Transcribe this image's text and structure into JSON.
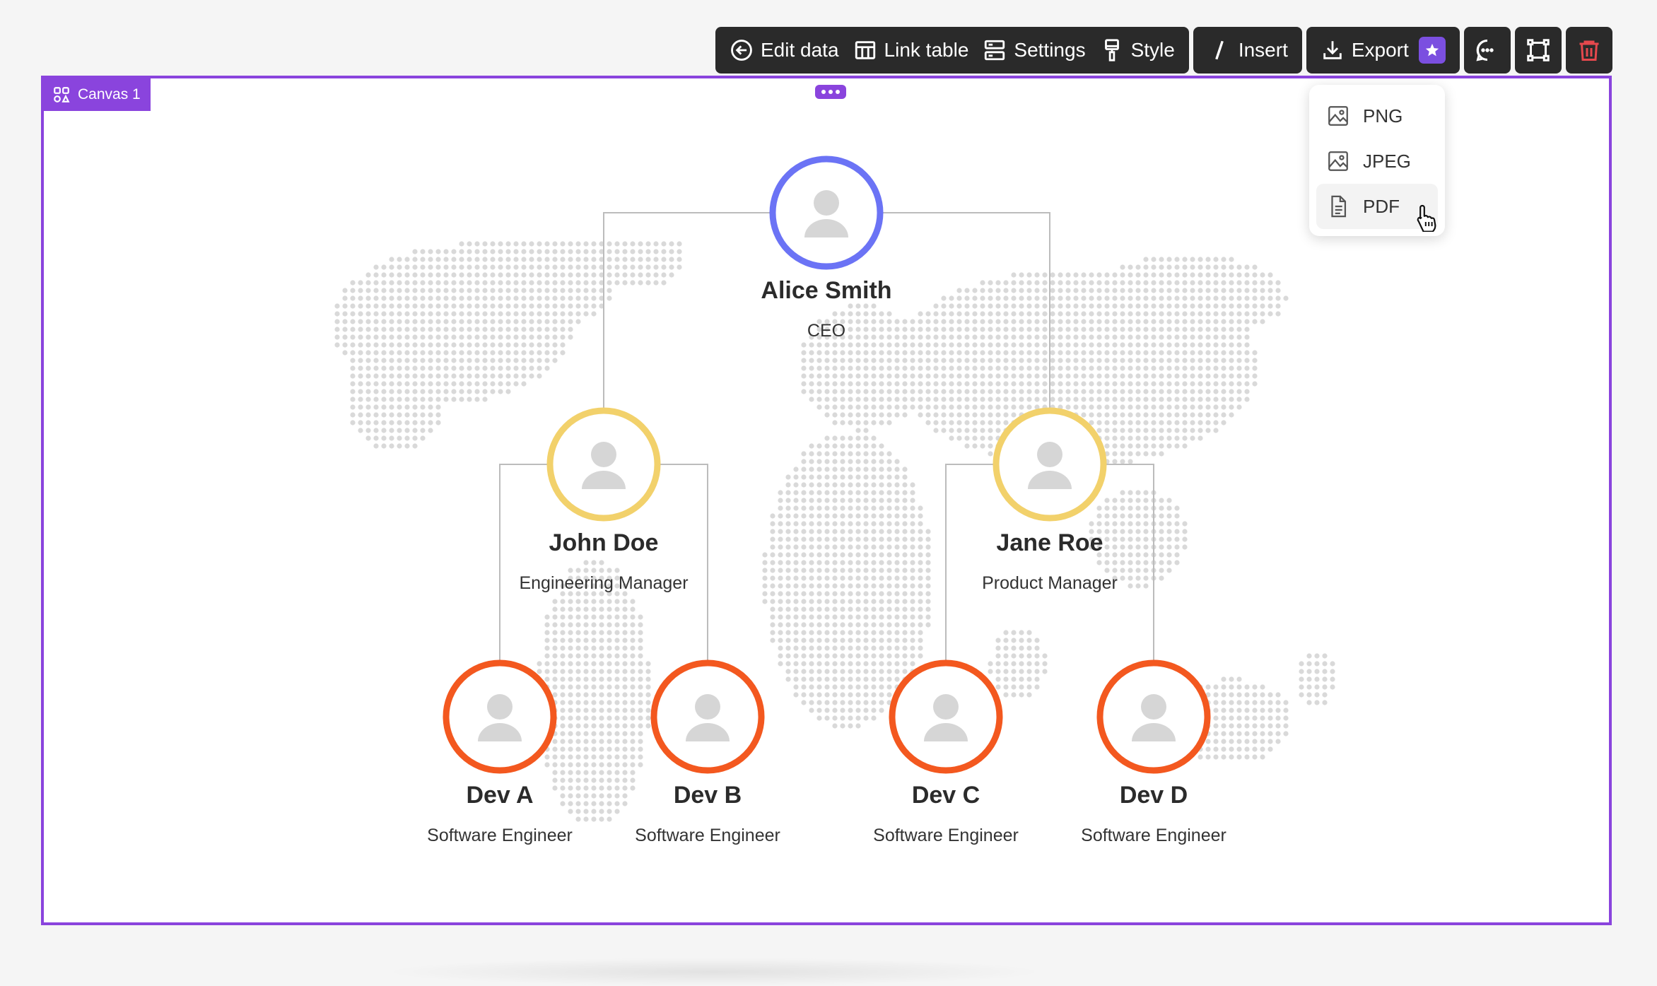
{
  "toolbar": {
    "edit_data": "Edit data",
    "link_table": "Link table",
    "settings": "Settings",
    "style": "Style",
    "insert": "Insert",
    "export": "Export"
  },
  "canvas": {
    "label": "Canvas 1"
  },
  "export_menu": {
    "items": [
      {
        "label": "PNG",
        "icon": "image-icon"
      },
      {
        "label": "JPEG",
        "icon": "image-icon"
      },
      {
        "label": "PDF",
        "icon": "document-icon"
      }
    ]
  },
  "colors": {
    "accent": "#8a44dd",
    "level1": "#6b73f5",
    "level2": "#f2d16b",
    "level3": "#f3581f",
    "delete": "#e5484d",
    "premium": "#7b4fe0"
  },
  "org": {
    "root": {
      "name": "Alice Smith",
      "role": "CEO"
    },
    "managers": [
      {
        "name": "John Doe",
        "role": "Engineering Manager"
      },
      {
        "name": "Jane Roe",
        "role": "Product Manager"
      }
    ],
    "engineers": [
      {
        "name": "Dev A",
        "role": "Software Engineer"
      },
      {
        "name": "Dev B",
        "role": "Software Engineer"
      },
      {
        "name": "Dev C",
        "role": "Software Engineer"
      },
      {
        "name": "Dev D",
        "role": "Software Engineer"
      }
    ]
  }
}
